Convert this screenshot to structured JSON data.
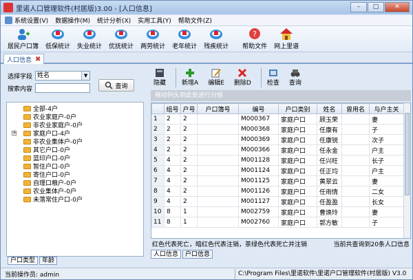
{
  "window": {
    "title": "里诺人口管理软件(村居版)3.00 - [人口信息]"
  },
  "menu": [
    "系统设置(V)",
    "数据操作(M)",
    "统计分析(X)",
    "实用工具(Y)",
    "帮助文件(Z)"
  ],
  "toolbar": [
    "居民户口簿",
    "低保统计",
    "失业统计",
    "优抚统计",
    "两劳统计",
    "老年统计",
    "残疾统计",
    "帮助文件",
    "网上里谱"
  ],
  "tab": {
    "label": "人口信息"
  },
  "search": {
    "field_label": "选择字段",
    "field_value": "姓名",
    "content_label": "搜索内容",
    "content_value": "",
    "query_button": "查询"
  },
  "tree": [
    "全部-4户",
    "农业家庭户-0户",
    "非农业家庭户-0户",
    "家庭户口-4户",
    "非农业集体户-0户",
    "其它户口-0户",
    "蓝印户口-0户",
    "暂住户口-0户",
    "寄住户口-0户",
    "自理口粮户-0户",
    "农业集体户-0户",
    "未落常住户口-0户"
  ],
  "left_tabs": [
    "户口类型",
    "年龄"
  ],
  "grid_toolbar": [
    "隐藏",
    "新增A",
    "编辑E",
    "删除D",
    "检查",
    "查询"
  ],
  "group_hint": "拖动列头到此处进行分组",
  "columns": [
    "组号",
    "户号",
    "户口簿号",
    "编号",
    "户口类别",
    "姓名",
    "曾用名",
    "与户主关"
  ],
  "rows": [
    [
      "1",
      "2",
      "2",
      "",
      "M000367",
      "家庭户口",
      "顾玉荣",
      "",
      "妻"
    ],
    [
      "2",
      "2",
      "2",
      "",
      "M000368",
      "家庭户口",
      "任康有",
      "",
      "子"
    ],
    [
      "3",
      "2",
      "2",
      "",
      "M000369",
      "家庭户口",
      "任康锐",
      "",
      "次子"
    ],
    [
      "4",
      "2",
      "2",
      "",
      "M000366",
      "家庭户口",
      "任永金",
      "",
      "户主"
    ],
    [
      "5",
      "4",
      "2",
      "",
      "M001128",
      "家庭户口",
      "任兴旺",
      "",
      "长子"
    ],
    [
      "6",
      "4",
      "2",
      "",
      "M001124",
      "家庭户口",
      "任正均",
      "",
      "户主"
    ],
    [
      "7",
      "4",
      "2",
      "",
      "M001125",
      "家庭户口",
      "黄翠云",
      "",
      "妻"
    ],
    [
      "8",
      "4",
      "2",
      "",
      "M001126",
      "家庭户口",
      "任雨情",
      "",
      "二女"
    ],
    [
      "9",
      "4",
      "2",
      "",
      "M001127",
      "家庭户口",
      "任盈盈",
      "",
      "长女"
    ],
    [
      "10",
      "8",
      "1",
      "",
      "M002759",
      "家庭户口",
      "曹焕玲",
      "",
      "妻"
    ],
    [
      "11",
      "8",
      "1",
      "",
      "M002760",
      "家庭户口",
      "郭方敏",
      "",
      "子"
    ]
  ],
  "legend": {
    "left": "红色代表死亡，暗红色代表注销，茶绿色代表死亡并注销",
    "right": "当前共查询到20条人口信息"
  },
  "right_tabs": [
    "人口信息",
    "户口信息"
  ],
  "status": {
    "operator": "当前操作员: admin",
    "path": "C:\\Program Files\\里诺软件\\里诺户口管理软件(村居版) V3.0"
  },
  "colors": {
    "accent": "#1d4f91",
    "folder": "#f2b33a"
  }
}
